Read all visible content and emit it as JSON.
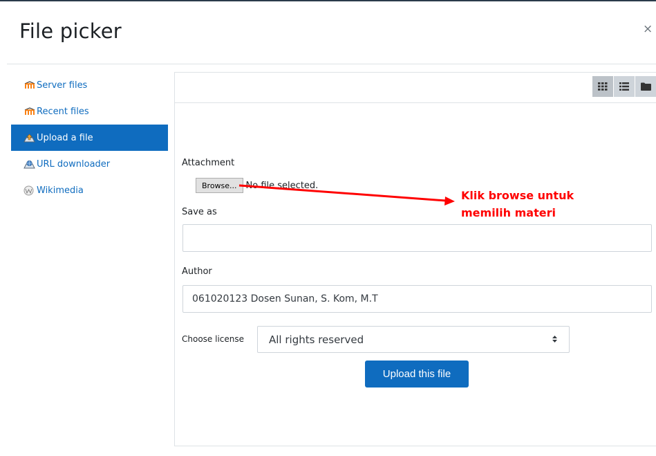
{
  "dialog": {
    "title": "File picker",
    "close_label": "×"
  },
  "sidebar": {
    "items": [
      {
        "label": "Server files",
        "icon": "moodle-icon",
        "active": false
      },
      {
        "label": "Recent files",
        "icon": "moodle-icon",
        "active": false
      },
      {
        "label": "Upload a file",
        "icon": "upload-icon",
        "active": true
      },
      {
        "label": "URL downloader",
        "icon": "url-downloader-icon",
        "active": false
      },
      {
        "label": "Wikimedia",
        "icon": "wikimedia-icon",
        "active": false
      }
    ]
  },
  "toolbar": {
    "views": [
      "grid-view-icon",
      "list-view-icon",
      "folder-view-icon"
    ]
  },
  "form": {
    "attachment_label": "Attachment",
    "browse_label": "Browse...",
    "no_file_text": "No file selected.",
    "save_as_label": "Save as",
    "save_as_value": "",
    "author_label": "Author",
    "author_value": "061020123 Dosen Sunan, S. Kom, M.T",
    "license_label": "Choose license",
    "license_value": "All rights reserved",
    "upload_label": "Upload this file"
  },
  "annotation": {
    "line1": "Klik browse untuk",
    "line2": "memilih materi",
    "color": "#ff0000"
  },
  "colors": {
    "accent": "#0f6cbf",
    "annotation": "#ff0000"
  }
}
